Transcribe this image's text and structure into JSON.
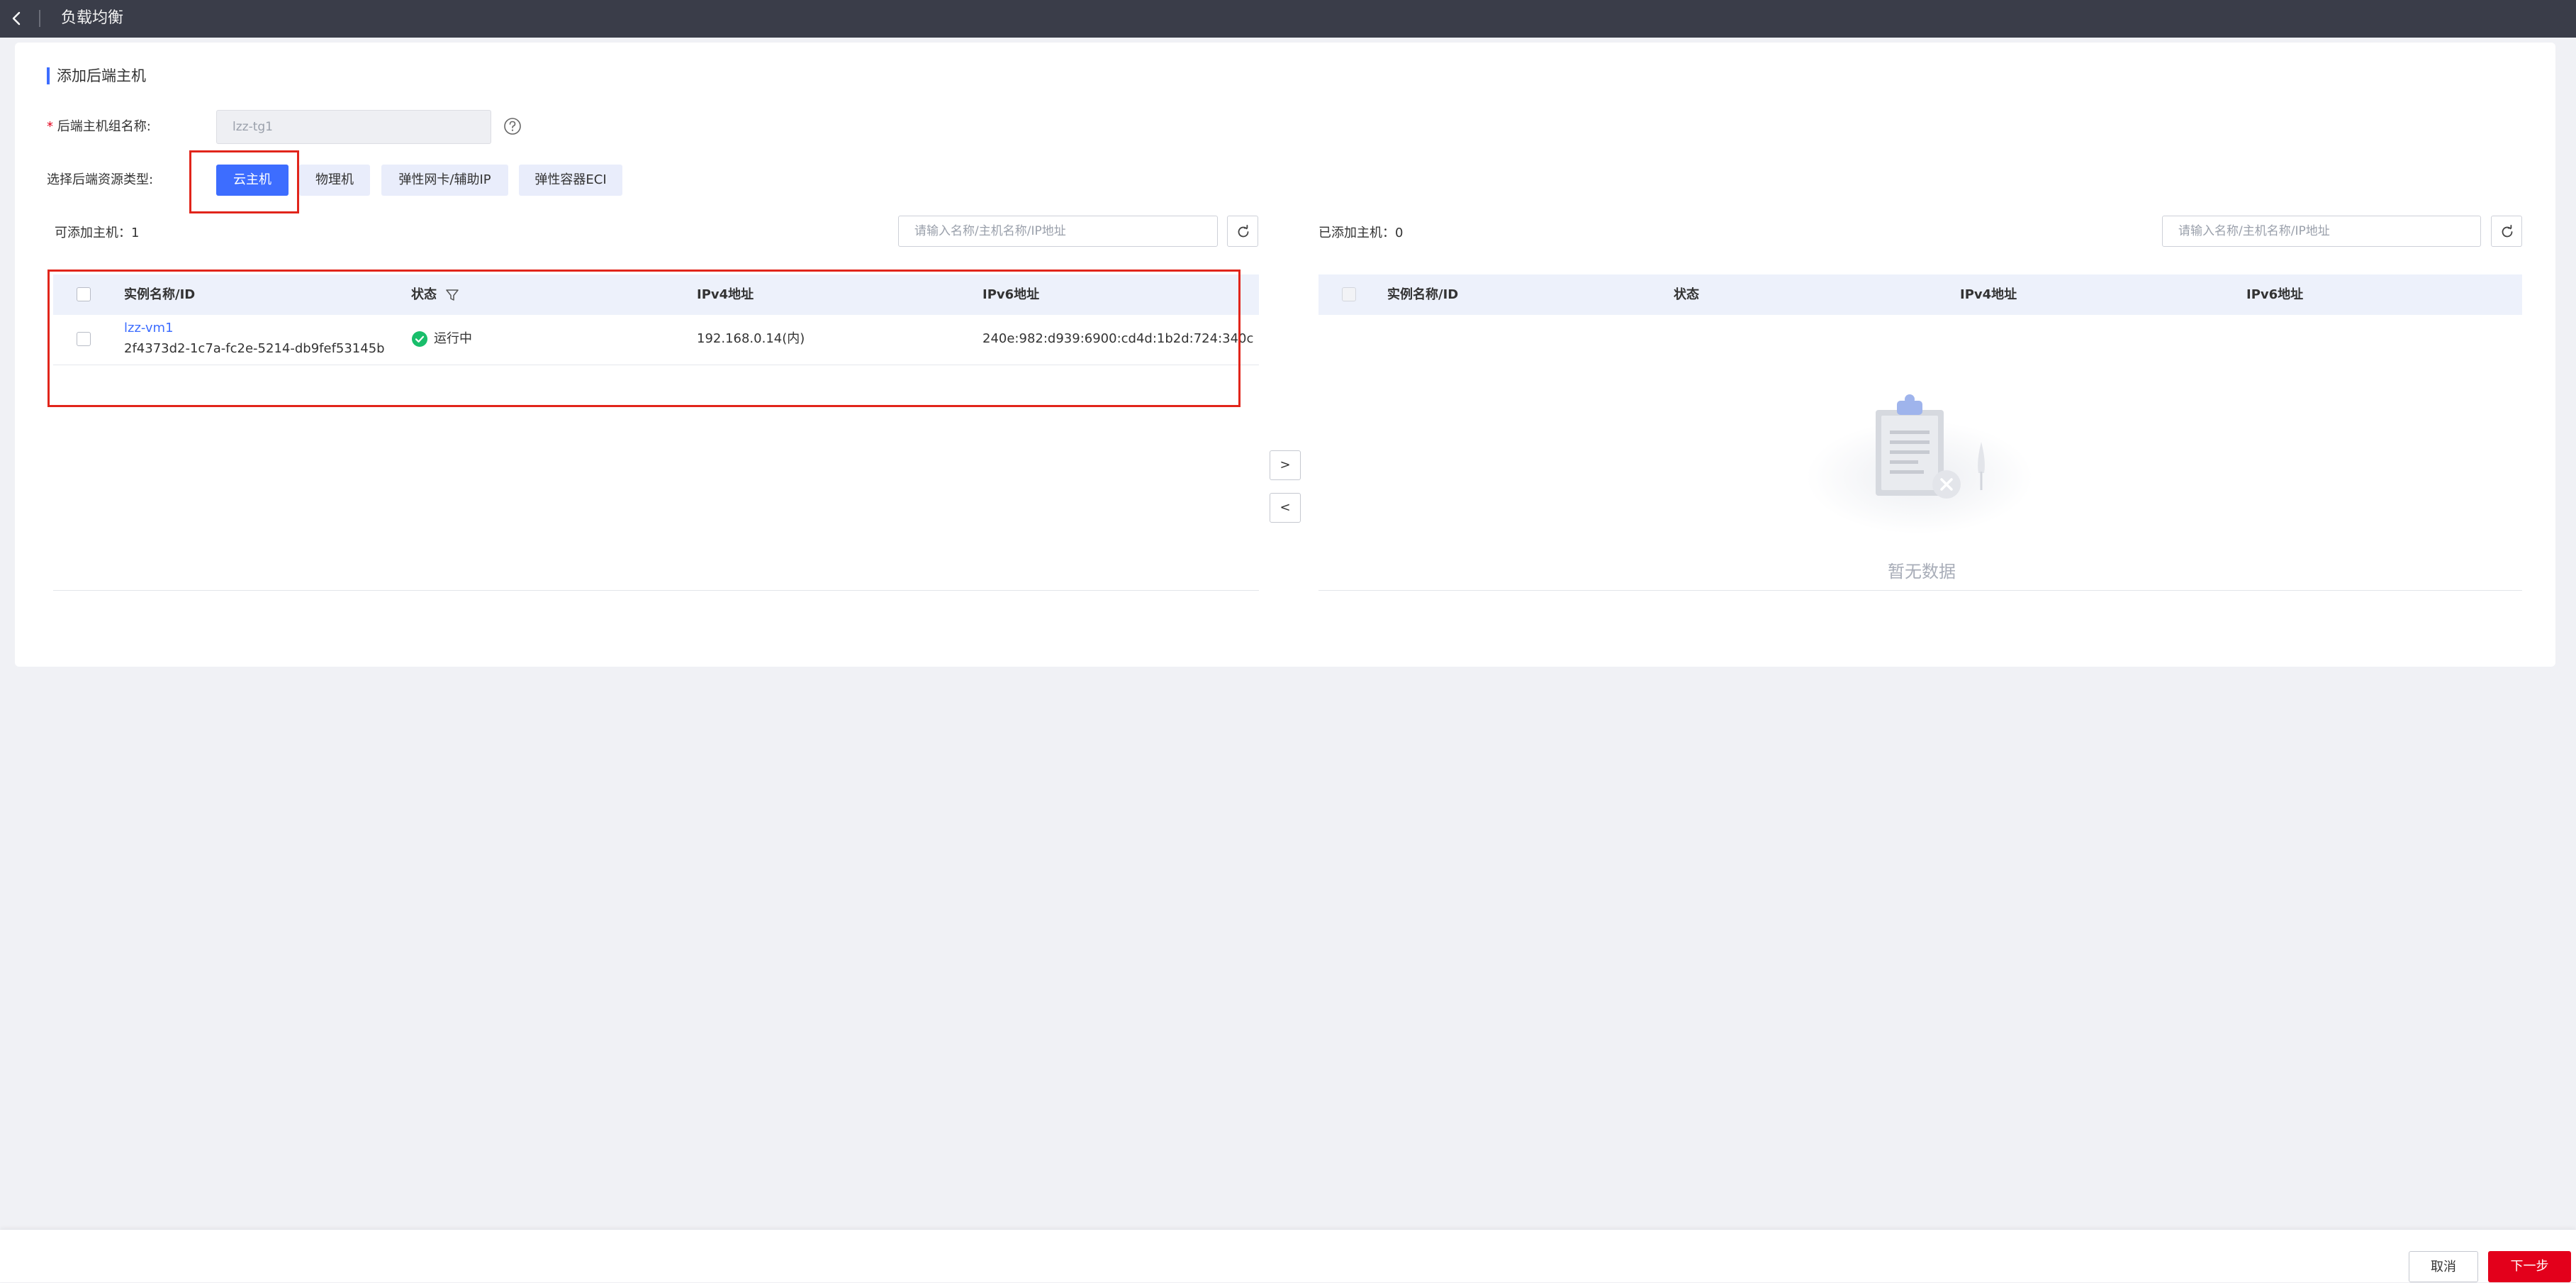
{
  "header": {
    "title": "负载均衡"
  },
  "section": {
    "title": "添加后端主机"
  },
  "form": {
    "group_name_label_required": "*",
    "group_name_label": "后端主机组名称:",
    "group_name_value": "lzz-tg1",
    "resource_type_label": "选择后端资源类型:",
    "resource_types": [
      "云主机",
      "物理机",
      "弹性网卡/辅助IP",
      "弹性容器ECI"
    ],
    "selected_resource_type": "云主机"
  },
  "available": {
    "count_label": "可添加主机：1",
    "search_placeholder": "请输入名称/主机名称/IP地址",
    "columns": [
      "实例名称/ID",
      "状态",
      "IPv4地址",
      "IPv6地址"
    ],
    "rows": [
      {
        "name": "lzz-vm1",
        "id": "2f4373d2-1c7a-fc2e-5214-db9fef53145b",
        "status": "运行中",
        "ipv4": "192.168.0.14(内)",
        "ipv6": "240e:982:d939:6900:cd4d:1b2d:724:340c"
      }
    ]
  },
  "added": {
    "count_label": "已添加主机：0",
    "search_placeholder": "请输入名称/主机名称/IP地址",
    "columns": [
      "实例名称/ID",
      "状态",
      "IPv4地址",
      "IPv6地址"
    ],
    "empty_text": "暂无数据"
  },
  "transfer": {
    "move_right": ">",
    "move_left": "<"
  },
  "footer": {
    "cancel": "取消",
    "next": "下一步"
  },
  "colors": {
    "primary": "#3d6dff",
    "danger": "#e3001b",
    "success": "#19be6b",
    "topbar": "#3a3d49"
  }
}
